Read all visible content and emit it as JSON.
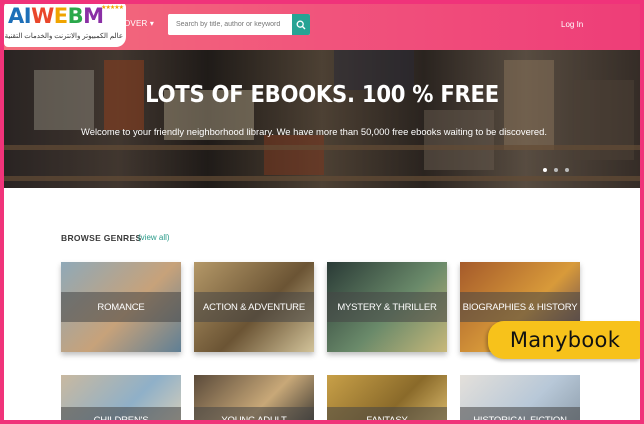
{
  "logo": {
    "text_a": "AI",
    "text_w": "W",
    "text_e": "E",
    "text_b": "B",
    "text_m": "M",
    "stars": "★★★★★",
    "subtitle": "عالم الكمبيوتر والانترنت والخدمات التقنية"
  },
  "header": {
    "discover_label": "OVER ▾",
    "search_placeholder": "Search by title, author or keyword",
    "login_label": "Log In"
  },
  "hero": {
    "title": "LOTS OF EBOOKS. 100 % FREE",
    "subtitle": "Welcome to your friendly neighborhood library. We have more than 50,000 free ebooks waiting to be discovered.",
    "slides": 3,
    "active_slide": 1
  },
  "genres": {
    "heading": "BROWSE GENRES",
    "view_all": "(view all)",
    "items": [
      {
        "label": "ROMANCE",
        "colors": [
          "#8fa9b8",
          "#c7a27a",
          "#5f7f95"
        ]
      },
      {
        "label": "ACTION & ADVENTURE",
        "colors": [
          "#b49868",
          "#6b5434",
          "#d2c39a"
        ]
      },
      {
        "label": "MYSTERY & THRILLER",
        "colors": [
          "#2a3a36",
          "#6a8a6a",
          "#c8b87a"
        ]
      },
      {
        "label": "BIOGRAPHIES & HISTORY",
        "colors": [
          "#a55a2a",
          "#d89a3a",
          "#4a3a5a"
        ]
      },
      {
        "label": "CHILDREN'S",
        "colors": [
          "#c9b9a0",
          "#8fb0c8",
          "#e0d2b8"
        ]
      },
      {
        "label": "YOUNG ADULT",
        "colors": [
          "#5a4a3a",
          "#c8a878",
          "#2a2a2a"
        ]
      },
      {
        "label": "FANTASY",
        "colors": [
          "#c8a048",
          "#8a6a2a",
          "#e8c878"
        ]
      },
      {
        "label": "HISTORICAL FICTION",
        "colors": [
          "#e4e0da",
          "#b8c8d8",
          "#8a9aa8"
        ]
      }
    ]
  },
  "badge": {
    "label": "Manybook"
  },
  "colors": {
    "brand_pink": "#f0337a",
    "accent_teal": "#27a394",
    "badge_yellow": "#f7c21b"
  }
}
